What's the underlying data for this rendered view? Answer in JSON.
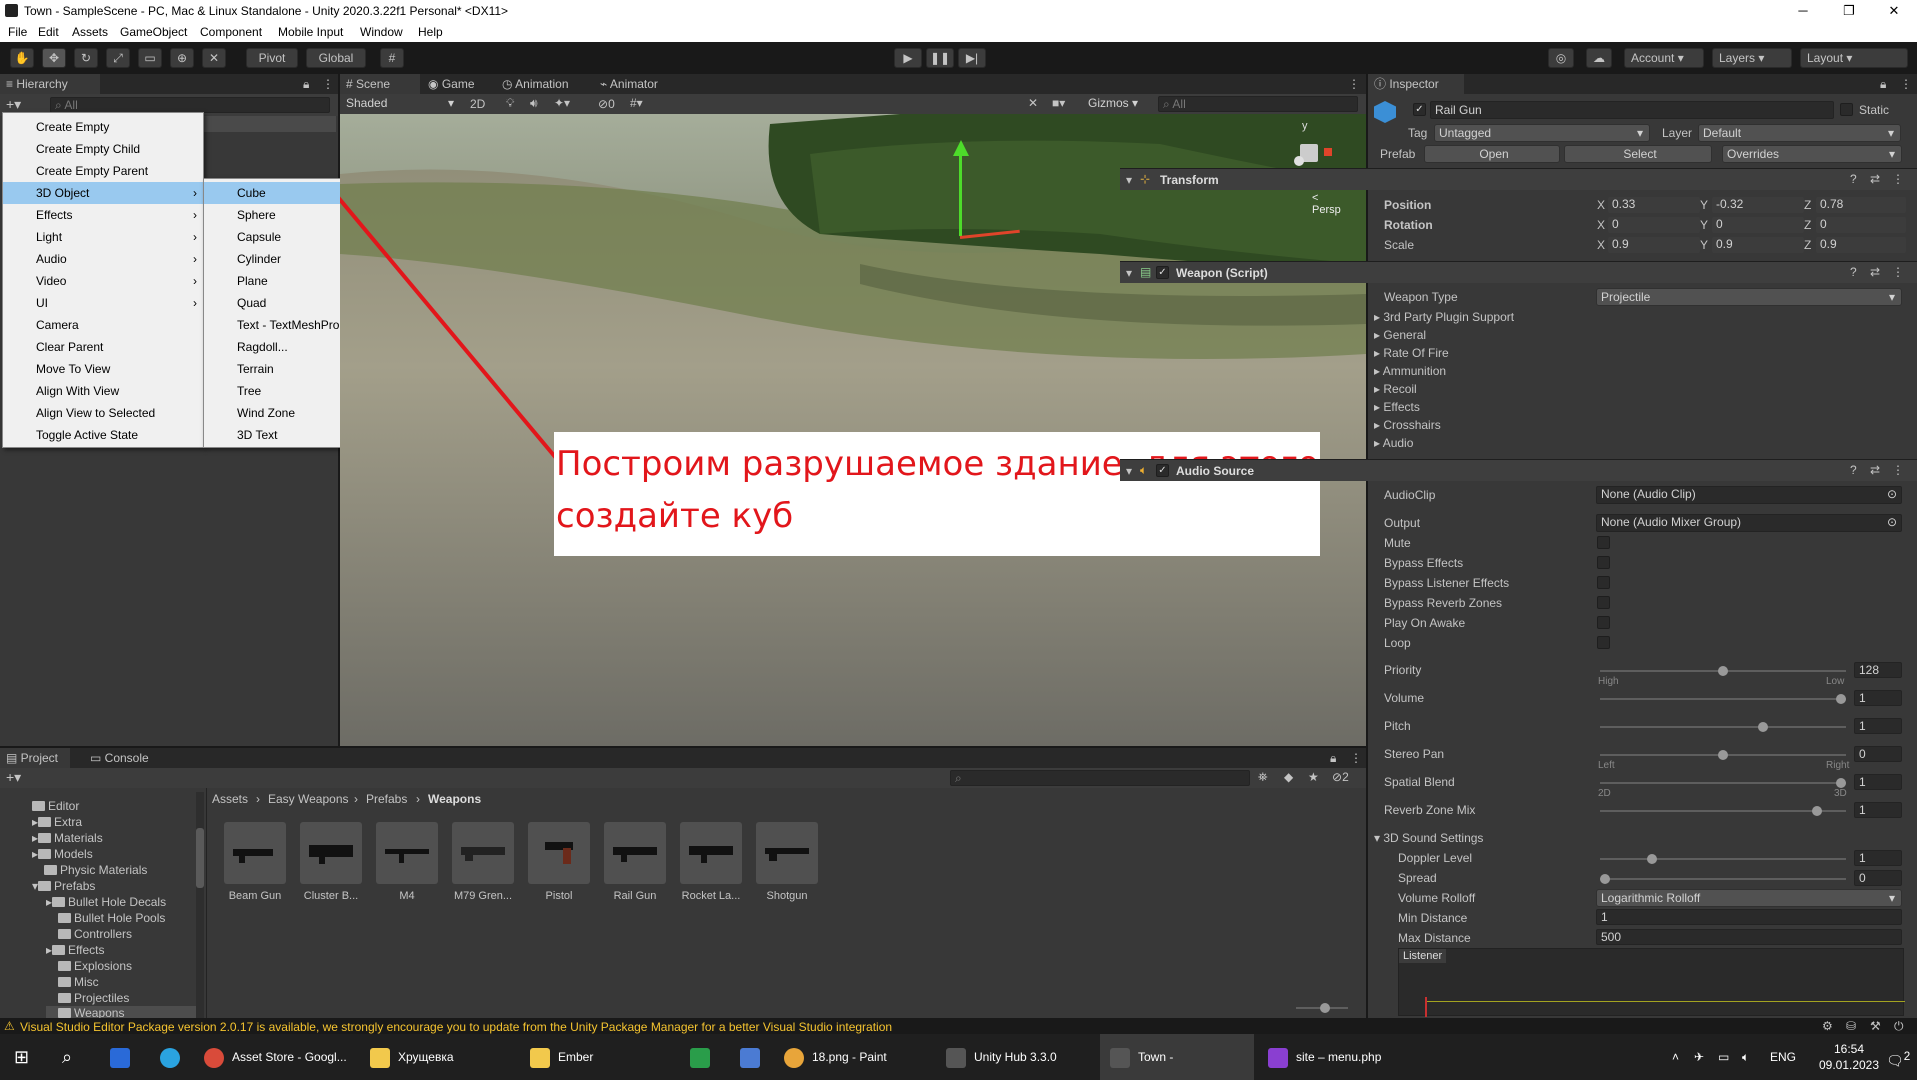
{
  "window": {
    "title": "Town - SampleScene - PC, Mac & Linux Standalone - Unity 2020.3.22f1 Personal* <DX11>",
    "min": "─",
    "max": "❐",
    "close": "✕"
  },
  "menu": [
    "File",
    "Edit",
    "Assets",
    "GameObject",
    "Component",
    "Mobile Input",
    "Window",
    "Help"
  ],
  "toolbar": {
    "pivot": "Pivot",
    "global": "Global",
    "account": "Account",
    "layers": "Layers",
    "layout": "Layout"
  },
  "hierarchy": {
    "tab": "Hierarchy",
    "search_placeholder": "All"
  },
  "context_menu": {
    "items": [
      "Create Empty",
      "Create Empty Child",
      "Create Empty Parent",
      "3D Object",
      "Effects",
      "Light",
      "Audio",
      "Video",
      "UI",
      "Camera",
      "Clear Parent",
      "Move To View",
      "Align With View",
      "Align View to Selected",
      "Toggle Active State"
    ],
    "submenu": [
      "Cube",
      "Sphere",
      "Capsule",
      "Cylinder",
      "Plane",
      "Quad",
      "Text - TextMeshPro",
      "Ragdoll...",
      "Terrain",
      "Tree",
      "Wind Zone",
      "3D Text"
    ]
  },
  "scene": {
    "tabs": [
      "Scene",
      "Game",
      "Animation",
      "Animator"
    ],
    "shading": "Shaded",
    "mode2d": "2D",
    "hidden_count": "0",
    "gizmos": "Gizmos",
    "search_placeholder": "All",
    "persp": "< Persp",
    "axis_y": "y"
  },
  "annotation": "Построим разрушаемое здание, для этого создайте куб",
  "inspector": {
    "tab": "Inspector",
    "object_name": "Rail Gun",
    "static": "Static",
    "tag_label": "Tag",
    "tag": "Untagged",
    "layer_label": "Layer",
    "layer": "Default",
    "prefab_label": "Prefab",
    "open": "Open",
    "select": "Select",
    "overrides": "Overrides",
    "transform": {
      "title": "Transform",
      "position_label": "Position",
      "rotation_label": "Rotation",
      "scale_label": "Scale",
      "position": [
        "0.33",
        "-0.32",
        "0.78"
      ],
      "rotation": [
        "0",
        "0",
        "0"
      ],
      "scale": [
        "0.9",
        "0.9",
        "0.9"
      ],
      "x": "X",
      "y": "Y",
      "z": "Z"
    },
    "weapon": {
      "title": "Weapon (Script)",
      "type_label": "Weapon Type",
      "type": "Projectile",
      "foldouts": [
        "3rd Party Plugin Support",
        "General",
        "Rate Of Fire",
        "Ammunition",
        "Recoil",
        "Effects",
        "Crosshairs",
        "Audio"
      ]
    },
    "audio": {
      "title": "Audio Source",
      "clip_label": "AudioClip",
      "clip": "None (Audio Clip)",
      "output_label": "Output",
      "output": "None (Audio Mixer Group)",
      "toggles": [
        "Mute",
        "Bypass Effects",
        "Bypass Listener Effects",
        "Bypass Reverb Zones",
        "Play On Awake",
        "Loop"
      ],
      "priority_label": "Priority",
      "priority": "128",
      "priority_value": 0.5,
      "high": "High",
      "low": "Low",
      "volume_label": "Volume",
      "volume": "1",
      "volume_value": 1,
      "pitch_label": "Pitch",
      "pitch": "1",
      "pitch_value": 0.67,
      "pan_label": "Stereo Pan",
      "pan": "0",
      "pan_value": 0.5,
      "left": "Left",
      "right": "Right",
      "blend_label": "Spatial Blend",
      "blend": "1",
      "blend_value": 1,
      "b2d": "2D",
      "b3d": "3D",
      "reverb_label": "Reverb Zone Mix",
      "reverb": "1",
      "reverb_value": 0.9,
      "sound3d": "3D Sound Settings",
      "doppler_label": "Doppler Level",
      "doppler": "1",
      "doppler_value": 0.2,
      "spread_label": "Spread",
      "spread": "0",
      "spread_value": 0,
      "rolloff_label": "Volume Rolloff",
      "rolloff": "Logarithmic Rolloff",
      "min_label": "Min Distance",
      "min": "1",
      "max_label": "Max Distance",
      "max": "500",
      "listener": "Listener"
    }
  },
  "project": {
    "tabs": [
      "Project",
      "Console"
    ],
    "hidden_count": "2",
    "breadcrumb": [
      "Assets",
      "Easy Weapons",
      "Prefabs",
      "Weapons"
    ],
    "tree": [
      "Editor",
      "Extra",
      "Materials",
      "Models",
      "Physic Materials",
      "Prefabs",
      "Bullet Hole Decals",
      "Bullet Hole Pools",
      "Controllers",
      "Effects",
      "Explosions",
      "Misc",
      "Projectiles",
      "Weapons"
    ],
    "assets": [
      "Beam Gun",
      "Cluster B...",
      "M4",
      "M79 Gren...",
      "Pistol",
      "Rail Gun",
      "Rocket La...",
      "Shotgun"
    ]
  },
  "status": "Visual Studio Editor Package version 2.0.17 is available, we strongly encourage you to update from the Unity Package Manager for a better Visual Studio integration",
  "taskbar": {
    "items": [
      "Asset Store - Googl...",
      "Хрущевка",
      "Ember",
      "18.png - Paint",
      "Unity Hub 3.3.0",
      "Town - SampleScen...",
      "site – menu.php"
    ],
    "lang": "ENG",
    "time": "16:54",
    "date": "09.01.2023",
    "notif": "2"
  },
  "colors": {
    "accent": "#99c9ef",
    "annotation": "#e2161b",
    "selected": "#3d6a99"
  }
}
